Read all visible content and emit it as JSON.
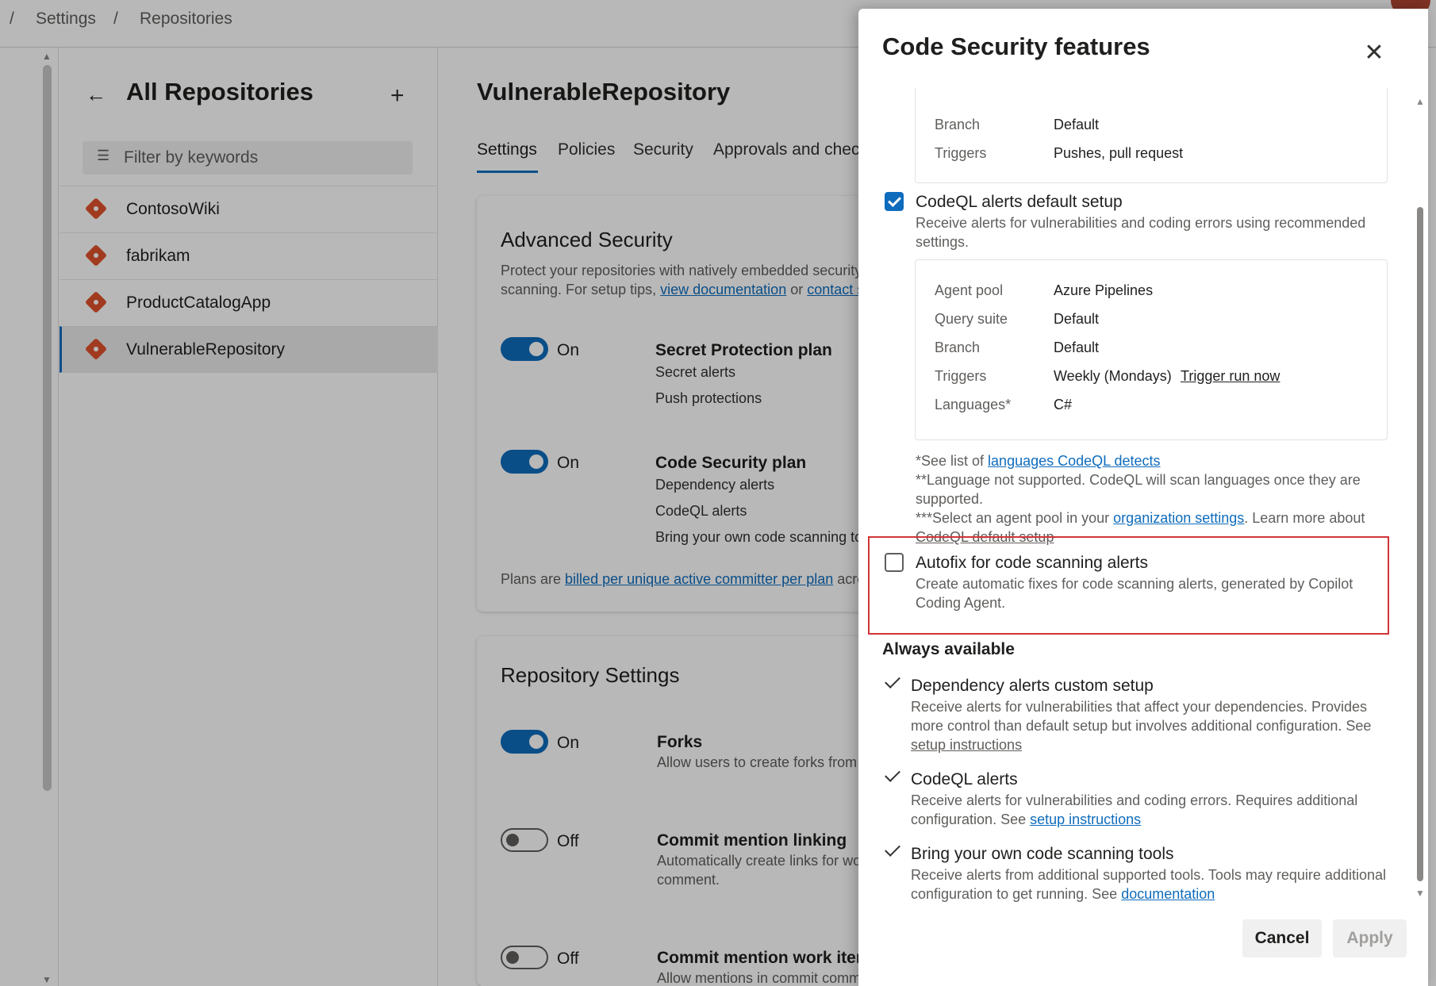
{
  "breadcrumb": {
    "sep1": "/",
    "item1": "Settings",
    "sep2": "/",
    "item2": "Repositories"
  },
  "repos_panel": {
    "back_icon": "arrow-left-icon",
    "title": "All Repositories",
    "add_icon": "plus-icon",
    "filter_placeholder": "Filter by keywords",
    "items": [
      {
        "name": "ContosoWiki"
      },
      {
        "name": "fabrikam"
      },
      {
        "name": "ProductCatalogApp"
      },
      {
        "name": "VulnerableRepository",
        "selected": true
      }
    ]
  },
  "main": {
    "heading": "VulnerableRepository",
    "tabs": [
      "Settings",
      "Policies",
      "Security",
      "Approvals and chec"
    ],
    "advanced_security": {
      "title": "Advanced Security",
      "desc_line1": "Protect your repositories with natively embedded security",
      "desc_line2_prefix": "scanning. For setup tips, ",
      "desc_link1": "view documentation",
      "desc_or": " or ",
      "desc_link2": "contact s",
      "secret_plan": {
        "toggle": "On",
        "title": "Secret Protection plan",
        "items": [
          "Secret alerts",
          "Push protections"
        ]
      },
      "code_plan": {
        "toggle": "On",
        "title": "Code Security plan",
        "items": [
          "Dependency alerts",
          "CodeQL alerts",
          "Bring your own code scanning to"
        ]
      },
      "billing_prefix": "Plans are ",
      "billing_link": "billed per unique active committer per plan",
      "billing_suffix": " acro"
    },
    "repo_settings": {
      "title": "Repository Settings",
      "forks": {
        "toggle": "On",
        "title": "Forks",
        "desc": "Allow users to create forks from"
      },
      "commit_linking": {
        "toggle": "Off",
        "title": "Commit mention linking",
        "desc1": "Automatically create links for wo",
        "desc2": "comment."
      },
      "commit_work_item": {
        "toggle": "Off",
        "title": "Commit mention work iten",
        "desc": "Allow mentions in commit comments to close work items (e.g. \"Fixes"
      }
    }
  },
  "dialog": {
    "title": "Code Security features",
    "close_icon": "close-icon",
    "top_box": {
      "rows": [
        {
          "k": "Branch",
          "v": "Default"
        },
        {
          "k": "Triggers",
          "v": "Pushes, pull request"
        }
      ]
    },
    "codeql_default": {
      "checked": true,
      "title": "CodeQL alerts default setup",
      "desc1": "Receive alerts for vulnerabilities and coding errors using recommended",
      "desc2": "settings.",
      "rows": [
        {
          "k": "Agent pool",
          "v": "Azure Pipelines"
        },
        {
          "k": "Query suite",
          "v": "Default"
        },
        {
          "k": "Branch",
          "v": "Default"
        },
        {
          "k": "Triggers",
          "v": "Weekly (Mondays)"
        },
        {
          "k": "Languages*",
          "v": "C#"
        }
      ],
      "trigger_link": "Trigger run now",
      "note1_prefix": "*See list of ",
      "note1_link": "languages CodeQL detects",
      "note2a": "**Language not supported. CodeQL will scan languages once they are",
      "note2b": "supported.",
      "note3_prefix": "***Select an agent pool in your ",
      "note3_link": "organization settings",
      "note3_suffix": ". Learn more about",
      "note3_link2": "CodeQL default setup"
    },
    "autofix": {
      "checked": false,
      "title": "Autofix for code scanning alerts",
      "desc1": "Create automatic fixes for code scanning alerts, generated by Copilot",
      "desc2": "Coding Agent."
    },
    "always_available": {
      "heading": "Always available",
      "items": [
        {
          "title": "Dependency alerts custom setup",
          "desc1": "Receive alerts for vulnerabilities that affect your dependencies. Provides",
          "desc2": "more control than default setup but involves additional configuration. See",
          "link": "setup instructions"
        },
        {
          "title": "CodeQL alerts",
          "desc1": "Receive alerts for vulnerabilities and coding errors. Requires additional",
          "desc2_prefix": "configuration. See ",
          "link": "setup instructions"
        },
        {
          "title": "Bring your own code scanning tools",
          "desc1": "Receive alerts from additional supported tools. Tools may require additional",
          "desc2_prefix": "configuration to get running. See ",
          "link": "documentation"
        }
      ]
    },
    "buttons": {
      "cancel": "Cancel",
      "apply": "Apply"
    },
    "highlight_color": "#d13438"
  },
  "colors": {
    "accent": "#0f6cbd",
    "git": "#e0532c"
  }
}
